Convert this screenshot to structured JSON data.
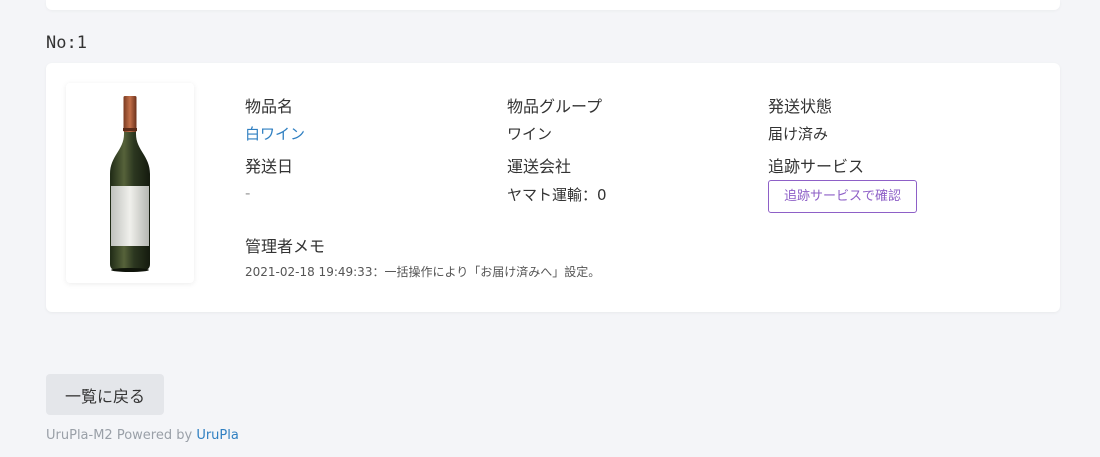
{
  "order": {
    "number_label": "No:1"
  },
  "item": {
    "image_alt": "wine-bottle",
    "labels": {
      "name": "物品名",
      "group": "物品グループ",
      "status": "発送状態",
      "ship_date": "発送日",
      "carrier": "運送会社",
      "tracking": "追跡サービス",
      "memo": "管理者メモ"
    },
    "values": {
      "name": "白ワイン",
      "group": "ワイン",
      "status": "届け済み",
      "ship_date": "-",
      "carrier": "ヤマト運輸：0",
      "tracking_button": "追跡サービスで確認",
      "memo": "2021-02-18 19:49:33：一括操作により「お届け済みへ」設定。"
    }
  },
  "actions": {
    "back_label": "一覧に戻る"
  },
  "footer": {
    "prefix": "UruPla-M2 Powered by ",
    "link": "UruPla"
  },
  "colors": {
    "link": "#2f7fc1",
    "accent": "#8e60c7",
    "background": "#f4f5f8"
  }
}
